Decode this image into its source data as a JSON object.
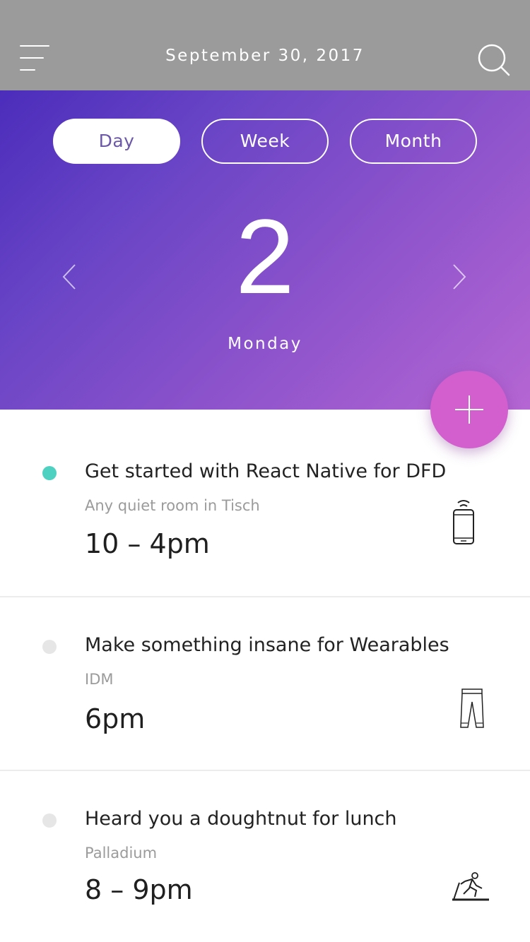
{
  "header": {
    "date": "September 30, 2017",
    "menu_icon": "hamburger-menu-icon",
    "search_icon": "search-icon"
  },
  "view_switch": {
    "options": [
      "Day",
      "Week",
      "Month"
    ],
    "selected": "Day"
  },
  "day": {
    "number": "2",
    "weekday": "Monday"
  },
  "fab_icon": "plus-icon",
  "events": [
    {
      "title": "Get started with React Native for DFD",
      "location": "Any quiet room in Tisch",
      "time": "10 – 4pm",
      "icon": "smartphone-icon",
      "current": true
    },
    {
      "title": "Make something insane for Wearables",
      "location": "IDM",
      "time": "6pm",
      "icon": "pants-icon",
      "current": false
    },
    {
      "title": "Heard you a doughtnut for lunch",
      "location": "Palladium",
      "time": "8 – 9pm",
      "icon": "treadmill-runner-icon",
      "current": false
    }
  ],
  "colors": {
    "header_bg": "#9b9b9b",
    "gradient_start": "#4b2dbb",
    "gradient_end": "#b566d3",
    "fab": "#d35fce",
    "current_dot": "#4fd1c1",
    "inactive_dot": "#e6e6e6"
  }
}
